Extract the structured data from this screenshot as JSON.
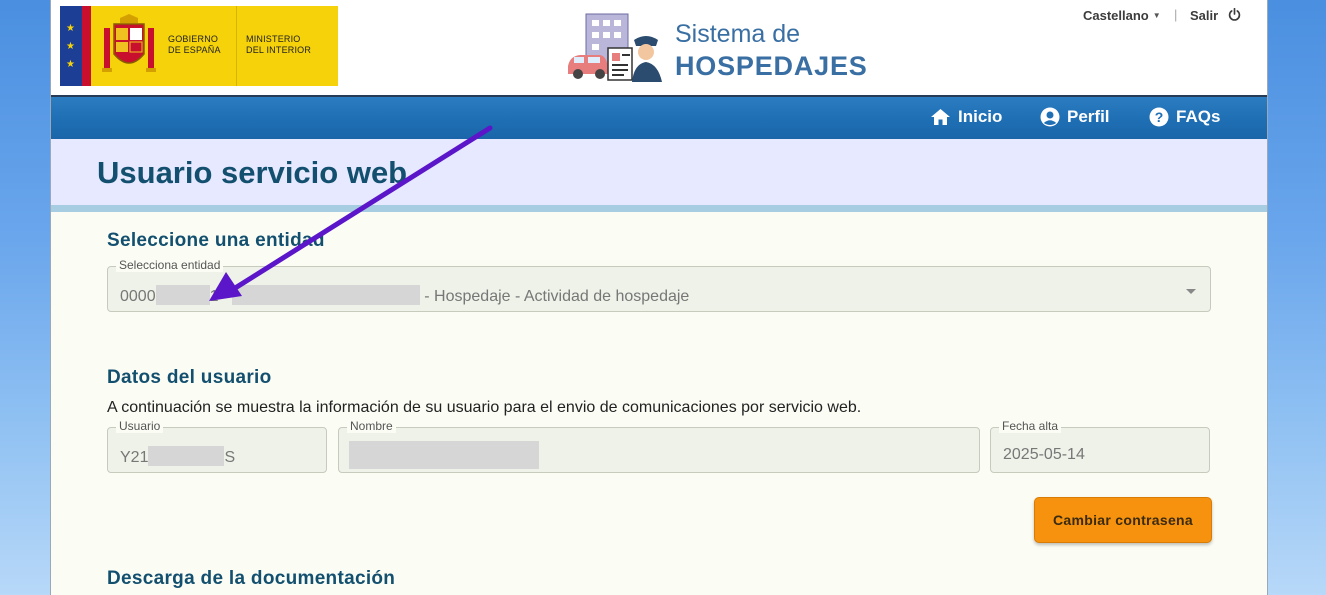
{
  "header": {
    "gov_logo": {
      "gobierno_line1": "GOBIERNO",
      "gobierno_line2": "DE ESPAÑA",
      "ministerio_line1": "MINISTERIO",
      "ministerio_line2": "DEL INTERIOR"
    },
    "system_title_line1": "Sistema de",
    "system_title_line2": "HOSPEDAJES",
    "language": "Castellano",
    "logout_label": "Salir"
  },
  "nav": {
    "items": [
      {
        "label": "Inicio",
        "icon": "home-icon"
      },
      {
        "label": "Perfil",
        "icon": "user-circle-icon"
      },
      {
        "label": "FAQs",
        "icon": "question-circle-icon"
      }
    ]
  },
  "page": {
    "title": "Usuario servicio web"
  },
  "entity_section": {
    "title": "Seleccione una entidad",
    "select_label": "Selecciona entidad",
    "value_prefix": "0000",
    "value_mid": "1 -",
    "value_suffix": "- Hospedaje - Actividad de hospedaje"
  },
  "user_section": {
    "title": "Datos del usuario",
    "description": "A continuación se muestra la información de su usuario para el envio de comunicaciones por servicio web.",
    "usuario_label": "Usuario",
    "usuario_prefix": "Y21",
    "usuario_suffix": "S",
    "nombre_label": "Nombre",
    "fecha_label": "Fecha alta",
    "fecha_value": "2025-05-14",
    "change_password_button": "Cambiar contrasena"
  },
  "docs_section": {
    "title": "Descarga de la documentación"
  },
  "colors": {
    "nav_blue": "#1f6fb5",
    "title_color": "#134f6e",
    "button_orange": "#f6920d",
    "arrow_purple": "#5b16c9"
  }
}
